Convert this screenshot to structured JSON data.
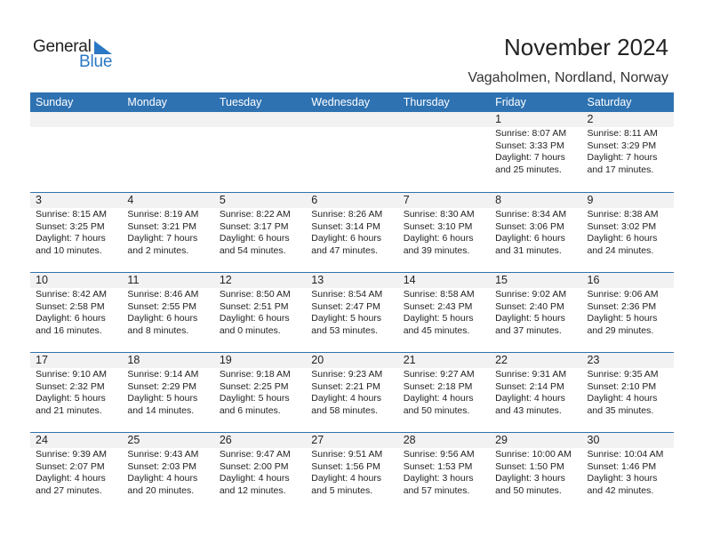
{
  "logo": {
    "word1": "General",
    "word2": "Blue"
  },
  "header": {
    "title": "November 2024",
    "location": "Vagaholmen, Nordland, Norway"
  },
  "colors": {
    "accent": "#2e72b2",
    "logo_blue": "#2a78c4",
    "date_band": "#f2f2f2"
  },
  "weekdays": [
    "Sunday",
    "Monday",
    "Tuesday",
    "Wednesday",
    "Thursday",
    "Friday",
    "Saturday"
  ],
  "weeks": [
    [
      {
        "day": "",
        "sunrise": "",
        "sunset": "",
        "daylight1": "",
        "daylight2": ""
      },
      {
        "day": "",
        "sunrise": "",
        "sunset": "",
        "daylight1": "",
        "daylight2": ""
      },
      {
        "day": "",
        "sunrise": "",
        "sunset": "",
        "daylight1": "",
        "daylight2": ""
      },
      {
        "day": "",
        "sunrise": "",
        "sunset": "",
        "daylight1": "",
        "daylight2": ""
      },
      {
        "day": "",
        "sunrise": "",
        "sunset": "",
        "daylight1": "",
        "daylight2": ""
      },
      {
        "day": "1",
        "sunrise": "Sunrise: 8:07 AM",
        "sunset": "Sunset: 3:33 PM",
        "daylight1": "Daylight: 7 hours",
        "daylight2": "and 25 minutes."
      },
      {
        "day": "2",
        "sunrise": "Sunrise: 8:11 AM",
        "sunset": "Sunset: 3:29 PM",
        "daylight1": "Daylight: 7 hours",
        "daylight2": "and 17 minutes."
      }
    ],
    [
      {
        "day": "3",
        "sunrise": "Sunrise: 8:15 AM",
        "sunset": "Sunset: 3:25 PM",
        "daylight1": "Daylight: 7 hours",
        "daylight2": "and 10 minutes."
      },
      {
        "day": "4",
        "sunrise": "Sunrise: 8:19 AM",
        "sunset": "Sunset: 3:21 PM",
        "daylight1": "Daylight: 7 hours",
        "daylight2": "and 2 minutes."
      },
      {
        "day": "5",
        "sunrise": "Sunrise: 8:22 AM",
        "sunset": "Sunset: 3:17 PM",
        "daylight1": "Daylight: 6 hours",
        "daylight2": "and 54 minutes."
      },
      {
        "day": "6",
        "sunrise": "Sunrise: 8:26 AM",
        "sunset": "Sunset: 3:14 PM",
        "daylight1": "Daylight: 6 hours",
        "daylight2": "and 47 minutes."
      },
      {
        "day": "7",
        "sunrise": "Sunrise: 8:30 AM",
        "sunset": "Sunset: 3:10 PM",
        "daylight1": "Daylight: 6 hours",
        "daylight2": "and 39 minutes."
      },
      {
        "day": "8",
        "sunrise": "Sunrise: 8:34 AM",
        "sunset": "Sunset: 3:06 PM",
        "daylight1": "Daylight: 6 hours",
        "daylight2": "and 31 minutes."
      },
      {
        "day": "9",
        "sunrise": "Sunrise: 8:38 AM",
        "sunset": "Sunset: 3:02 PM",
        "daylight1": "Daylight: 6 hours",
        "daylight2": "and 24 minutes."
      }
    ],
    [
      {
        "day": "10",
        "sunrise": "Sunrise: 8:42 AM",
        "sunset": "Sunset: 2:58 PM",
        "daylight1": "Daylight: 6 hours",
        "daylight2": "and 16 minutes."
      },
      {
        "day": "11",
        "sunrise": "Sunrise: 8:46 AM",
        "sunset": "Sunset: 2:55 PM",
        "daylight1": "Daylight: 6 hours",
        "daylight2": "and 8 minutes."
      },
      {
        "day": "12",
        "sunrise": "Sunrise: 8:50 AM",
        "sunset": "Sunset: 2:51 PM",
        "daylight1": "Daylight: 6 hours",
        "daylight2": "and 0 minutes."
      },
      {
        "day": "13",
        "sunrise": "Sunrise: 8:54 AM",
        "sunset": "Sunset: 2:47 PM",
        "daylight1": "Daylight: 5 hours",
        "daylight2": "and 53 minutes."
      },
      {
        "day": "14",
        "sunrise": "Sunrise: 8:58 AM",
        "sunset": "Sunset: 2:43 PM",
        "daylight1": "Daylight: 5 hours",
        "daylight2": "and 45 minutes."
      },
      {
        "day": "15",
        "sunrise": "Sunrise: 9:02 AM",
        "sunset": "Sunset: 2:40 PM",
        "daylight1": "Daylight: 5 hours",
        "daylight2": "and 37 minutes."
      },
      {
        "day": "16",
        "sunrise": "Sunrise: 9:06 AM",
        "sunset": "Sunset: 2:36 PM",
        "daylight1": "Daylight: 5 hours",
        "daylight2": "and 29 minutes."
      }
    ],
    [
      {
        "day": "17",
        "sunrise": "Sunrise: 9:10 AM",
        "sunset": "Sunset: 2:32 PM",
        "daylight1": "Daylight: 5 hours",
        "daylight2": "and 21 minutes."
      },
      {
        "day": "18",
        "sunrise": "Sunrise: 9:14 AM",
        "sunset": "Sunset: 2:29 PM",
        "daylight1": "Daylight: 5 hours",
        "daylight2": "and 14 minutes."
      },
      {
        "day": "19",
        "sunrise": "Sunrise: 9:18 AM",
        "sunset": "Sunset: 2:25 PM",
        "daylight1": "Daylight: 5 hours",
        "daylight2": "and 6 minutes."
      },
      {
        "day": "20",
        "sunrise": "Sunrise: 9:23 AM",
        "sunset": "Sunset: 2:21 PM",
        "daylight1": "Daylight: 4 hours",
        "daylight2": "and 58 minutes."
      },
      {
        "day": "21",
        "sunrise": "Sunrise: 9:27 AM",
        "sunset": "Sunset: 2:18 PM",
        "daylight1": "Daylight: 4 hours",
        "daylight2": "and 50 minutes."
      },
      {
        "day": "22",
        "sunrise": "Sunrise: 9:31 AM",
        "sunset": "Sunset: 2:14 PM",
        "daylight1": "Daylight: 4 hours",
        "daylight2": "and 43 minutes."
      },
      {
        "day": "23",
        "sunrise": "Sunrise: 9:35 AM",
        "sunset": "Sunset: 2:10 PM",
        "daylight1": "Daylight: 4 hours",
        "daylight2": "and 35 minutes."
      }
    ],
    [
      {
        "day": "24",
        "sunrise": "Sunrise: 9:39 AM",
        "sunset": "Sunset: 2:07 PM",
        "daylight1": "Daylight: 4 hours",
        "daylight2": "and 27 minutes."
      },
      {
        "day": "25",
        "sunrise": "Sunrise: 9:43 AM",
        "sunset": "Sunset: 2:03 PM",
        "daylight1": "Daylight: 4 hours",
        "daylight2": "and 20 minutes."
      },
      {
        "day": "26",
        "sunrise": "Sunrise: 9:47 AM",
        "sunset": "Sunset: 2:00 PM",
        "daylight1": "Daylight: 4 hours",
        "daylight2": "and 12 minutes."
      },
      {
        "day": "27",
        "sunrise": "Sunrise: 9:51 AM",
        "sunset": "Sunset: 1:56 PM",
        "daylight1": "Daylight: 4 hours",
        "daylight2": "and 5 minutes."
      },
      {
        "day": "28",
        "sunrise": "Sunrise: 9:56 AM",
        "sunset": "Sunset: 1:53 PM",
        "daylight1": "Daylight: 3 hours",
        "daylight2": "and 57 minutes."
      },
      {
        "day": "29",
        "sunrise": "Sunrise: 10:00 AM",
        "sunset": "Sunset: 1:50 PM",
        "daylight1": "Daylight: 3 hours",
        "daylight2": "and 50 minutes."
      },
      {
        "day": "30",
        "sunrise": "Sunrise: 10:04 AM",
        "sunset": "Sunset: 1:46 PM",
        "daylight1": "Daylight: 3 hours",
        "daylight2": "and 42 minutes."
      }
    ]
  ]
}
